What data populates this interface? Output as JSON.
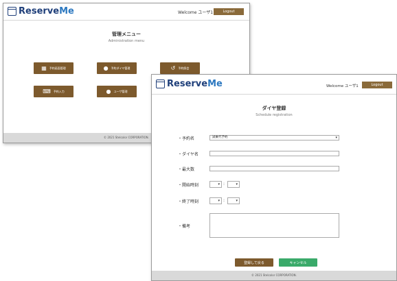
{
  "brand": {
    "logo_text": "Reserve",
    "logo_text_accent": "Me"
  },
  "header": {
    "welcome": "Welcome ユーザ1",
    "logout_label": "Logout"
  },
  "admin_menu": {
    "title": "管理メニュー",
    "subtitle": "Administration menu",
    "buttons": [
      {
        "label": "予約画面管理",
        "icon": "list-icon"
      },
      {
        "label": "予約ダイヤ管理",
        "icon": "clock-icon"
      },
      {
        "label": "予約照会",
        "icon": "history-icon"
      },
      {
        "label": "予約入力",
        "icon": "keyboard-icon"
      },
      {
        "label": "ユーザ管理",
        "icon": "user-icon"
      }
    ],
    "footer": "© 2021 Stelcolor CORPORATION."
  },
  "schedule_form": {
    "title": "ダイヤ登録",
    "subtitle": "Schedule registration",
    "fields": {
      "reservation_name": {
        "label": "・予約名",
        "value": "試乗代予約"
      },
      "dia_name": {
        "label": "・ダイヤ名"
      },
      "max_count": {
        "label": "・最大数"
      },
      "start_time": {
        "label": "・開始時刻",
        "sep": ":"
      },
      "end_time": {
        "label": "・終了時刻",
        "sep": ":"
      },
      "remarks": {
        "label": "・備考"
      }
    },
    "register_label": "登録して戻る",
    "cancel_label": "キャンセル",
    "footer": "© 2021 Stelcolor CORPORATION.",
    "colors": {
      "register": "#7d5a2d",
      "cancel": "#3aaa6a"
    }
  }
}
